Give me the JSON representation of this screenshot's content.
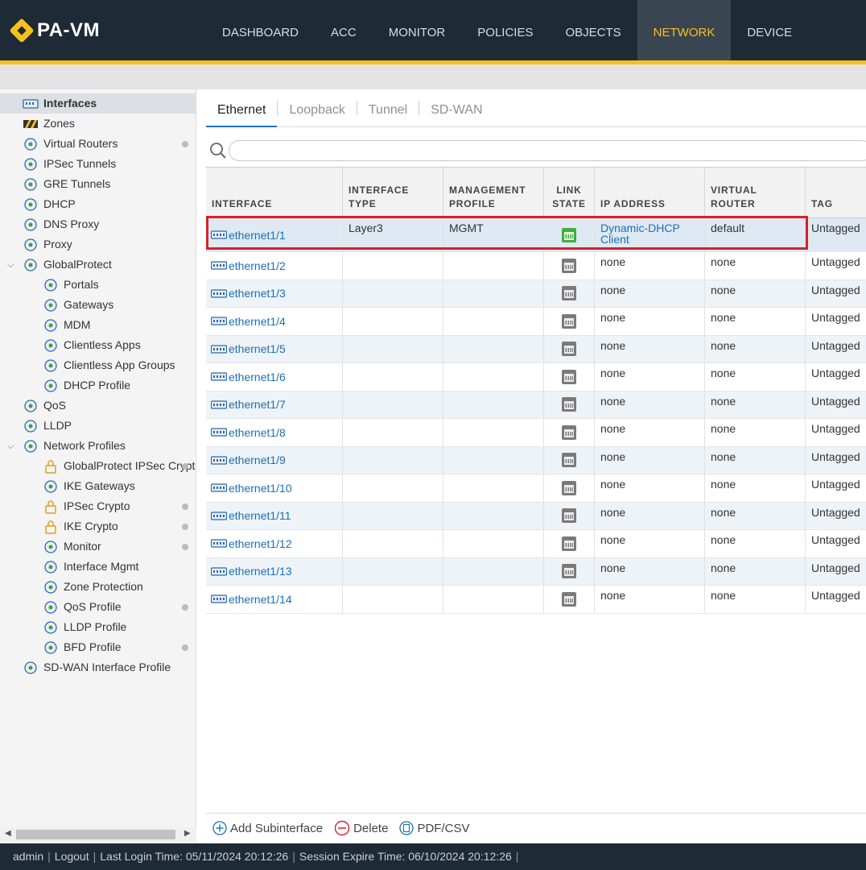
{
  "app": {
    "name": "PA-VM"
  },
  "nav": {
    "tabs": [
      "DASHBOARD",
      "ACC",
      "MONITOR",
      "POLICIES",
      "OBJECTS",
      "NETWORK",
      "DEVICE"
    ],
    "active": "NETWORK"
  },
  "sidebar": {
    "items": [
      {
        "label": "Interfaces",
        "icon": "interfaces-icon",
        "active": true
      },
      {
        "label": "Zones",
        "icon": "zones-icon"
      },
      {
        "label": "Virtual Routers",
        "icon": "virtual-router-icon",
        "dot": true
      },
      {
        "label": "IPSec Tunnels",
        "icon": "ipsec-tunnel-icon"
      },
      {
        "label": "GRE Tunnels",
        "icon": "gre-tunnel-icon"
      },
      {
        "label": "DHCP",
        "icon": "dhcp-icon"
      },
      {
        "label": "DNS Proxy",
        "icon": "dns-proxy-icon"
      },
      {
        "label": "Proxy",
        "icon": "proxy-icon"
      },
      {
        "label": "GlobalProtect",
        "icon": "globalprotect-icon",
        "expanded": true
      },
      {
        "label": "Portals",
        "icon": "portals-icon",
        "child": true
      },
      {
        "label": "Gateways",
        "icon": "gateways-icon",
        "child": true
      },
      {
        "label": "MDM",
        "icon": "mdm-icon",
        "child": true
      },
      {
        "label": "Clientless Apps",
        "icon": "clientless-apps-icon",
        "child": true
      },
      {
        "label": "Clientless App Groups",
        "icon": "clientless-app-groups-icon",
        "child": true
      },
      {
        "label": "DHCP Profile",
        "icon": "dhcp-profile-icon",
        "child": true
      },
      {
        "label": "QoS",
        "icon": "qos-icon"
      },
      {
        "label": "LLDP",
        "icon": "lldp-icon"
      },
      {
        "label": "Network Profiles",
        "icon": "network-profiles-icon",
        "expanded": true
      },
      {
        "label": "GlobalProtect IPSec Crypto",
        "icon": "lock-icon",
        "child": true,
        "dot": true
      },
      {
        "label": "IKE Gateways",
        "icon": "ike-gateways-icon",
        "child": true
      },
      {
        "label": "IPSec Crypto",
        "icon": "lock-icon",
        "child": true,
        "dot": true
      },
      {
        "label": "IKE Crypto",
        "icon": "lock-icon",
        "child": true,
        "dot": true
      },
      {
        "label": "Monitor",
        "icon": "monitor-icon",
        "child": true,
        "dot": true
      },
      {
        "label": "Interface Mgmt",
        "icon": "interface-mgmt-icon",
        "child": true
      },
      {
        "label": "Zone Protection",
        "icon": "zone-protection-icon",
        "child": true
      },
      {
        "label": "QoS Profile",
        "icon": "qos-profile-icon",
        "child": true,
        "dot": true
      },
      {
        "label": "LLDP Profile",
        "icon": "lldp-profile-icon",
        "child": true
      },
      {
        "label": "BFD Profile",
        "icon": "bfd-profile-icon",
        "child": true,
        "dot": true
      },
      {
        "label": "SD-WAN Interface Profile",
        "icon": "sdwan-profile-icon"
      }
    ]
  },
  "tabs": [
    "Ethernet",
    "Loopback",
    "Tunnel",
    "SD-WAN"
  ],
  "active_tab": "Ethernet",
  "search": {
    "value": "",
    "placeholder": ""
  },
  "table": {
    "headers": {
      "interface": "INTERFACE",
      "type": "INTERFACE TYPE",
      "mgmt_1": "MANAGEMENT",
      "mgmt_2": "PROFILE",
      "link_1": "LINK",
      "link_2": "STATE",
      "ip": "IP ADDRESS",
      "vr_1": "VIRTUAL",
      "vr_2": "ROUTER",
      "tag": "TAG"
    },
    "rows": [
      {
        "interface": "ethernet1/1",
        "type": "Layer3",
        "mgmt": "MGMT",
        "link": "up",
        "ip": "Dynamic-DHCP Client",
        "vr": "default",
        "tag": "Untagged"
      },
      {
        "interface": "ethernet1/2",
        "type": "",
        "mgmt": "",
        "link": "down",
        "ip": "none",
        "vr": "none",
        "tag": "Untagged"
      },
      {
        "interface": "ethernet1/3",
        "type": "",
        "mgmt": "",
        "link": "down",
        "ip": "none",
        "vr": "none",
        "tag": "Untagged"
      },
      {
        "interface": "ethernet1/4",
        "type": "",
        "mgmt": "",
        "link": "down",
        "ip": "none",
        "vr": "none",
        "tag": "Untagged"
      },
      {
        "interface": "ethernet1/5",
        "type": "",
        "mgmt": "",
        "link": "down",
        "ip": "none",
        "vr": "none",
        "tag": "Untagged"
      },
      {
        "interface": "ethernet1/6",
        "type": "",
        "mgmt": "",
        "link": "down",
        "ip": "none",
        "vr": "none",
        "tag": "Untagged"
      },
      {
        "interface": "ethernet1/7",
        "type": "",
        "mgmt": "",
        "link": "down",
        "ip": "none",
        "vr": "none",
        "tag": "Untagged"
      },
      {
        "interface": "ethernet1/8",
        "type": "",
        "mgmt": "",
        "link": "down",
        "ip": "none",
        "vr": "none",
        "tag": "Untagged"
      },
      {
        "interface": "ethernet1/9",
        "type": "",
        "mgmt": "",
        "link": "down",
        "ip": "none",
        "vr": "none",
        "tag": "Untagged"
      },
      {
        "interface": "ethernet1/10",
        "type": "",
        "mgmt": "",
        "link": "down",
        "ip": "none",
        "vr": "none",
        "tag": "Untagged"
      },
      {
        "interface": "ethernet1/11",
        "type": "",
        "mgmt": "",
        "link": "down",
        "ip": "none",
        "vr": "none",
        "tag": "Untagged"
      },
      {
        "interface": "ethernet1/12",
        "type": "",
        "mgmt": "",
        "link": "down",
        "ip": "none",
        "vr": "none",
        "tag": "Untagged"
      },
      {
        "interface": "ethernet1/13",
        "type": "",
        "mgmt": "",
        "link": "down",
        "ip": "none",
        "vr": "none",
        "tag": "Untagged"
      },
      {
        "interface": "ethernet1/14",
        "type": "",
        "mgmt": "",
        "link": "down",
        "ip": "none",
        "vr": "none",
        "tag": "Untagged"
      }
    ]
  },
  "actions": {
    "add_subinterface": "Add Subinterface",
    "delete": "Delete",
    "pdf_csv": "PDF/CSV"
  },
  "footer": {
    "user": "admin",
    "logout": "Logout",
    "last_login": "Last Login Time: 05/11/2024 20:12:26",
    "session_expire": "Session Expire Time: 06/10/2024 20:12:26"
  },
  "colors": {
    "nav_bg": "#1e2a35",
    "accent": "#f7c11c",
    "link": "#1a6fb8",
    "highlight": "#d8202c",
    "link_up": "#3fae3f",
    "link_down": "#7a7a7a"
  }
}
